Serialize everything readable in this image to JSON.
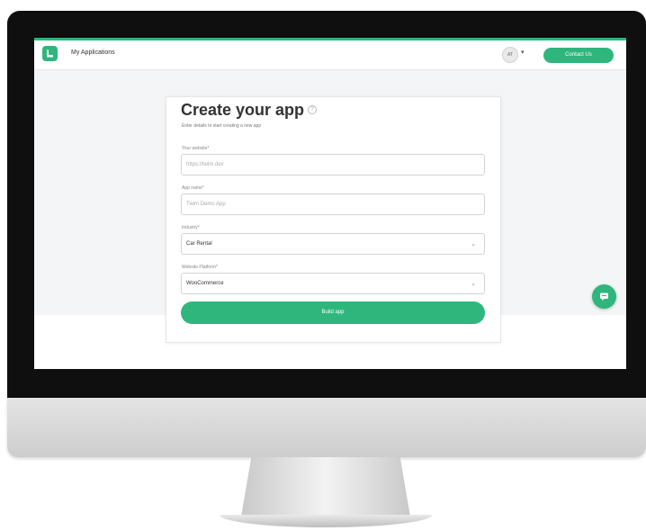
{
  "colors": {
    "brand_green": "#2eb67d",
    "bezel": "#0f0f10",
    "screen_bg": "#f4f5f6"
  },
  "header": {
    "logo_icon": "phone-logo-icon",
    "title": "My Applications",
    "avatar_initials": "AT",
    "avatar_caret_icon": "chevron-down-icon",
    "contact_label": "Contact Us"
  },
  "form": {
    "title": "Create your app",
    "help_icon": "info-icon",
    "subtitle": "Enter details to start creating a new app",
    "fields": [
      {
        "label": "Your website*",
        "placeholder": "https://twim.dev",
        "value": ""
      },
      {
        "label": "App name*",
        "placeholder": "Twim Demo App",
        "value": ""
      },
      {
        "label": "Industry*",
        "value": "Car Rental",
        "type": "select"
      },
      {
        "label": "Website Platform*",
        "value": "WooCommerce",
        "type": "select"
      }
    ],
    "submit_label": "Build app"
  },
  "chat": {
    "icon": "chat-icon"
  }
}
